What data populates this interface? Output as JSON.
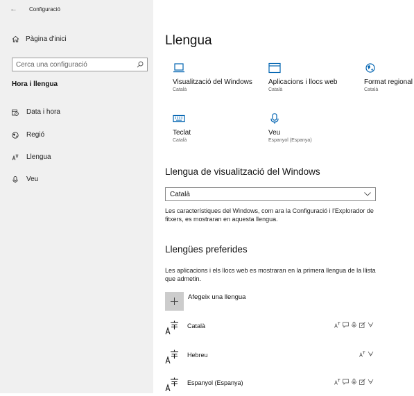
{
  "window": {
    "title": "Configuració"
  },
  "sidebar": {
    "home_label": "Pàgina d'inici",
    "search_placeholder": "Cerca una configuració",
    "section_heading": "Hora i llengua",
    "items": [
      {
        "label": "Data i hora",
        "icon": "calendar-clock-icon"
      },
      {
        "label": "Regió",
        "icon": "globe-region-icon"
      },
      {
        "label": "Llengua",
        "icon": "language-icon"
      },
      {
        "label": "Veu",
        "icon": "microphone-icon"
      }
    ]
  },
  "main": {
    "title": "Llengua",
    "tiles": [
      {
        "label": "Visualització del Windows",
        "sub": "Català",
        "icon": "laptop-icon"
      },
      {
        "label": "Aplicacions i llocs web",
        "sub": "Català",
        "icon": "browser-window-icon"
      },
      {
        "label": "Format regional",
        "sub": "Català",
        "icon": "globe-settings-icon"
      },
      {
        "label": "Teclat",
        "sub": "Català",
        "icon": "keyboard-icon"
      },
      {
        "label": "Veu",
        "sub": "Espanyol (Espanya)",
        "icon": "microphone-icon"
      }
    ],
    "display_language": {
      "heading": "Llengua de visualització del Windows",
      "selected": "Català",
      "description": "Les característiques del Windows, com ara la Configuració i l'Explorador de fitxers, es mostraran en aquesta llengua."
    },
    "preferred": {
      "heading": "Llengües preferides",
      "description": "Les aplicacions i els llocs web es mostraran en la primera llengua de la llista que admetin.",
      "add_label": "Afegeix una llengua",
      "languages": [
        {
          "name": "Català",
          "features": [
            "language-pack-icon",
            "speech-icon",
            "voice-icon",
            "handwriting-icon",
            "spelling-icon"
          ]
        },
        {
          "name": "Hebreu",
          "features": [
            "language-pack-icon",
            "spelling-icon"
          ]
        },
        {
          "name": "Espanyol (Espanya)",
          "features": [
            "language-pack-icon",
            "speech-icon",
            "voice-icon",
            "handwriting-icon",
            "spelling-icon"
          ]
        }
      ]
    }
  },
  "colors": {
    "sidebar_bg": "#f0f0f0",
    "accent": "#0063b1",
    "add_button_bg": "#cccccc"
  }
}
